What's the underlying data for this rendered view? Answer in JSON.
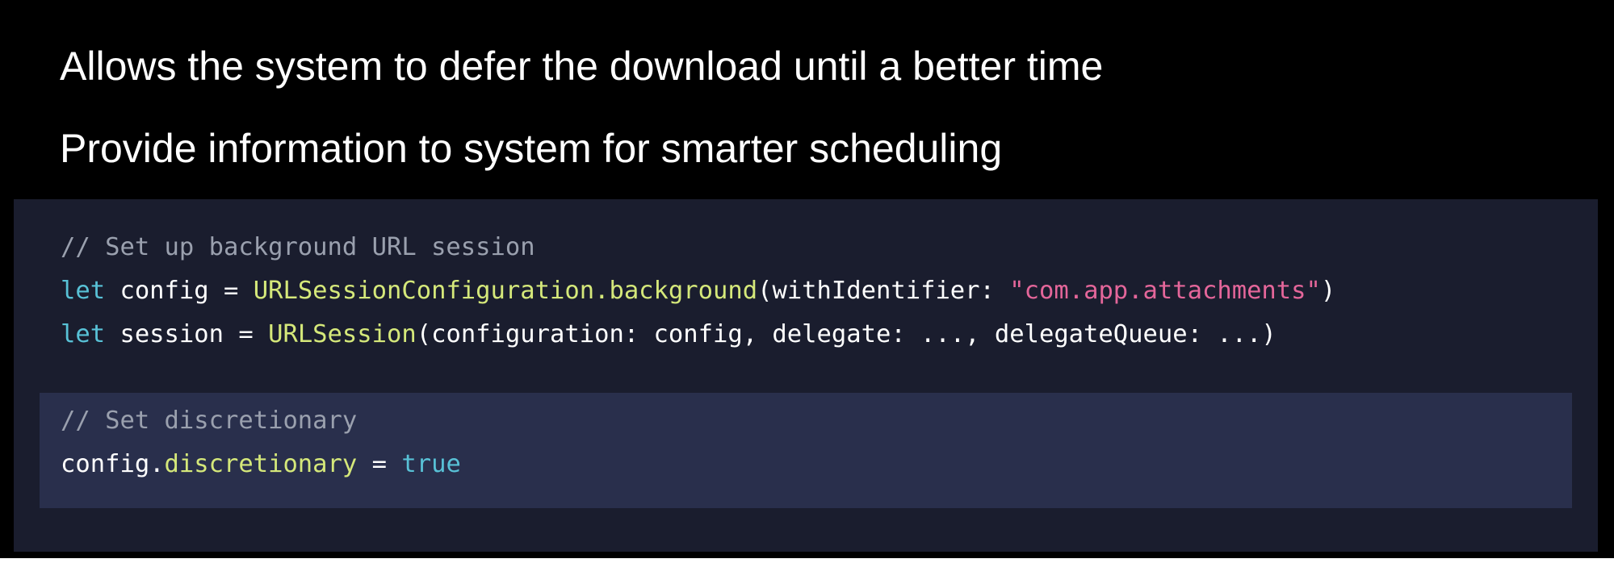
{
  "slide": {
    "bullets": [
      "Allows the system to defer the download until a better time",
      "Provide information to system for smarter scheduling"
    ]
  },
  "code": {
    "lines": [
      {
        "comment": "// Set up background URL session"
      },
      {
        "kw": "let",
        "sp1": " config = ",
        "type1": "URLSessionConfiguration",
        "dot": ".",
        "type2": "background",
        "args": "(withIdentifier: ",
        "str": "\"com.app.attachments\"",
        "close": ")"
      },
      {
        "kw": "let",
        "sp1": " session = ",
        "type1": "URLSession",
        "args": "(configuration: config, delegate: ..., delegateQueue: ...)"
      },
      {
        "comment": "// Set discretionary"
      },
      {
        "obj": "config.",
        "prop": "discretionary",
        "eq": " = ",
        "val": "true"
      }
    ]
  },
  "colors": {
    "background": "#000000",
    "code_panel": "#1a1d2e",
    "highlight": "#292f4c",
    "comment": "#9aa0ae",
    "keyword": "#58c1d6",
    "type": "#d5e87a",
    "string": "#e4669a"
  }
}
